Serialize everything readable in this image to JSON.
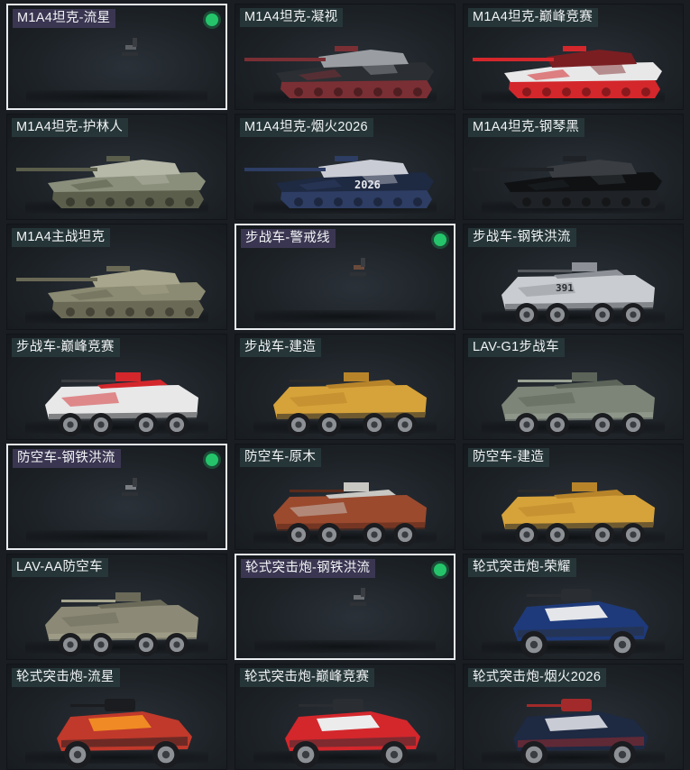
{
  "items": [
    {
      "label": "M1A4坦克-流星",
      "kind": "empty",
      "selected": true,
      "owned": true,
      "colors": [
        "#5b5f63"
      ],
      "icon": "tank-preview-placeholder-icon"
    },
    {
      "label": "M1A4坦克-凝视",
      "kind": "tank",
      "selected": false,
      "owned": false,
      "colors": [
        "#2b2f33",
        "#7a2f34",
        "#9a9ea2"
      ],
      "icon": "tank-icon"
    },
    {
      "label": "M1A4坦克-巅峰竞赛",
      "kind": "tank",
      "selected": false,
      "owned": false,
      "colors": [
        "#e8e8e8",
        "#d3272c",
        "#7a1e22"
      ],
      "icon": "tank-icon"
    },
    {
      "label": "M1A4坦克-护林人",
      "kind": "tank",
      "selected": false,
      "owned": false,
      "colors": [
        "#8a8f7c",
        "#5a5e4b",
        "#b6b8a8"
      ],
      "icon": "tank-icon"
    },
    {
      "label": "M1A4坦克-烟火2026",
      "kind": "tank",
      "selected": false,
      "owned": false,
      "colors": [
        "#1e2942",
        "#2d3d63",
        "#c9ccd4"
      ],
      "icon": "tank-icon",
      "decal": "2026"
    },
    {
      "label": "M1A4坦克-钢琴黑",
      "kind": "tank",
      "selected": false,
      "owned": false,
      "colors": [
        "#0f1113",
        "#1f2226",
        "#3a3d41"
      ],
      "icon": "tank-icon"
    },
    {
      "label": "M1A4主战坦克",
      "kind": "tank",
      "selected": false,
      "owned": false,
      "colors": [
        "#8b8a72",
        "#6a6955",
        "#a8a68c"
      ],
      "icon": "tank-icon"
    },
    {
      "label": "步战车-警戒线",
      "kind": "empty",
      "selected": true,
      "owned": true,
      "colors": [
        "#6a4a3a"
      ],
      "icon": "ifv-preview-placeholder-icon"
    },
    {
      "label": "步战车-钢铁洪流",
      "kind": "ifv",
      "selected": false,
      "owned": false,
      "colors": [
        "#c9ccd0",
        "#8d9197",
        "#55595e"
      ],
      "icon": "ifv-icon",
      "decal": "391"
    },
    {
      "label": "步战车-巅峰竞赛",
      "kind": "ifv",
      "selected": false,
      "owned": false,
      "colors": [
        "#e8e8e8",
        "#d3272c",
        "#3a3d41"
      ],
      "icon": "ifv-icon"
    },
    {
      "label": "步战车-建造",
      "kind": "ifv",
      "selected": false,
      "owned": false,
      "colors": [
        "#d6a23a",
        "#b8842a",
        "#2a2a2a"
      ],
      "icon": "ifv-icon"
    },
    {
      "label": "LAV-G1步战车",
      "kind": "ifv",
      "selected": false,
      "owned": false,
      "colors": [
        "#7c8577",
        "#5c6459",
        "#9aa294"
      ],
      "icon": "ifv-icon"
    },
    {
      "label": "防空车-钢铁洪流",
      "kind": "empty",
      "selected": true,
      "owned": true,
      "colors": [
        "#7a7e82"
      ],
      "icon": "aa-preview-placeholder-icon"
    },
    {
      "label": "防空车-原木",
      "kind": "ifv",
      "selected": false,
      "owned": false,
      "colors": [
        "#9b4a2e",
        "#c9c7c2",
        "#5a2a1b"
      ],
      "icon": "aa-vehicle-icon"
    },
    {
      "label": "防空车-建造",
      "kind": "ifv",
      "selected": false,
      "owned": false,
      "colors": [
        "#d6a23a",
        "#b8842a",
        "#2a2a2a"
      ],
      "icon": "aa-vehicle-icon"
    },
    {
      "label": "LAV-AA防空车",
      "kind": "ifv",
      "selected": false,
      "owned": false,
      "colors": [
        "#8c8a76",
        "#6b6a59",
        "#a8a690"
      ],
      "icon": "aa-vehicle-icon"
    },
    {
      "label": "轮式突击炮-钢铁洪流",
      "kind": "empty",
      "selected": true,
      "owned": true,
      "colors": [
        "#6a6e72"
      ],
      "icon": "assault-gun-preview-placeholder-icon"
    },
    {
      "label": "轮式突击炮-荣耀",
      "kind": "apc",
      "selected": false,
      "owned": false,
      "colors": [
        "#1e3a7a",
        "#e4e6ea",
        "#2a2d31"
      ],
      "icon": "assault-gun-icon"
    },
    {
      "label": "轮式突击炮-流星",
      "kind": "apc",
      "selected": false,
      "owned": false,
      "colors": [
        "#c0392b",
        "#f08a24",
        "#1a1c1f"
      ],
      "icon": "assault-gun-icon"
    },
    {
      "label": "轮式突击炮-巅峰竞赛",
      "kind": "apc",
      "selected": false,
      "owned": false,
      "colors": [
        "#d3272c",
        "#ececec",
        "#2a2d31"
      ],
      "icon": "assault-gun-icon"
    },
    {
      "label": "轮式突击炮-烟火2026",
      "kind": "apc",
      "selected": false,
      "owned": false,
      "colors": [
        "#1e2942",
        "#c9ccd4",
        "#a22a2a"
      ],
      "icon": "assault-gun-icon"
    }
  ]
}
